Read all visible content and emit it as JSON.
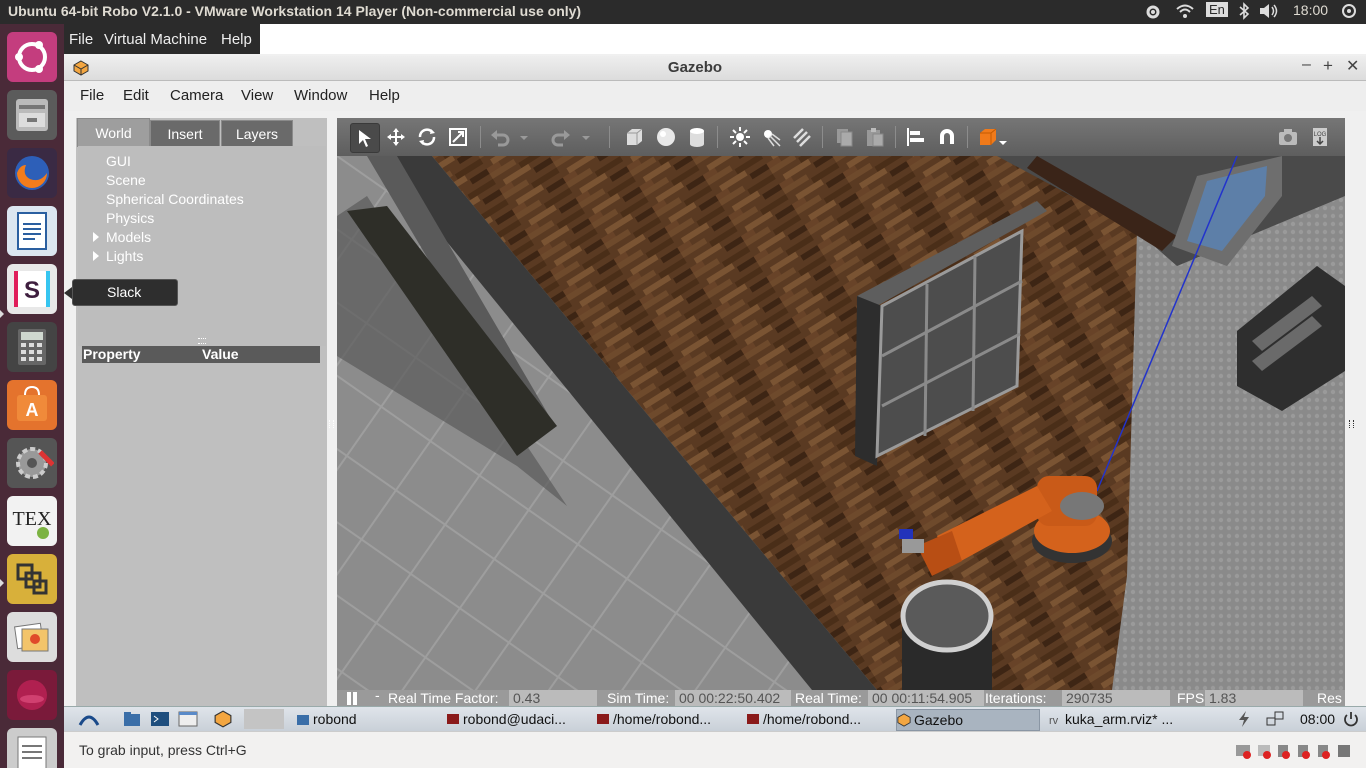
{
  "topbar": {
    "title": "Ubuntu 64-bit Robo V2.1.0 - VMware Workstation 14 Player (Non-commercial use only)",
    "keyboard": "En",
    "clock": "18:00"
  },
  "launcher": {
    "tooltip": "Slack",
    "items": [
      "ubuntu-dash",
      "files",
      "firefox",
      "libreoffice-writer",
      "slack",
      "calculator",
      "software-center",
      "system-settings",
      "texmaker",
      "vmware-player",
      "shotwell",
      "vmware",
      "text-editor"
    ]
  },
  "vmware_menu": [
    "File",
    "Virtual Machine",
    "Help"
  ],
  "gazebo": {
    "window_title": "Gazebo",
    "menu": [
      "File",
      "Edit",
      "Camera",
      "View",
      "Window",
      "Help"
    ],
    "tabs": [
      "World",
      "Insert",
      "Layers"
    ],
    "tree": [
      "GUI",
      "Scene",
      "Spherical Coordinates",
      "Physics",
      "Models",
      "Lights"
    ],
    "props": {
      "property": "Property",
      "value": "Value"
    },
    "status": {
      "real_time_factor_label": "Real Time Factor:",
      "real_time_factor": "0.43",
      "sim_time_label": "Sim Time:",
      "sim_time": "00 00:22:50.402",
      "real_time_label": "Real Time:",
      "real_time": "00 00:11:54.905",
      "iterations_label": "Iterations:",
      "iterations": "290735",
      "fps_label": "FPS:",
      "fps": "1.83",
      "reset_label": "Res"
    }
  },
  "taskbar": {
    "items": [
      "robond",
      "robond@udaci...",
      "/home/robond...",
      "/home/robond...",
      "Gazebo",
      "kuka_arm.rviz* ..."
    ],
    "clock": "08:00"
  },
  "vm_status": "To grab input, press Ctrl+G",
  "colors": {
    "launcher_bg": "#4a2a38",
    "toolbar_bg": "#6a6a6a",
    "floor": "#5a3a22",
    "robot": "#d4621c"
  }
}
